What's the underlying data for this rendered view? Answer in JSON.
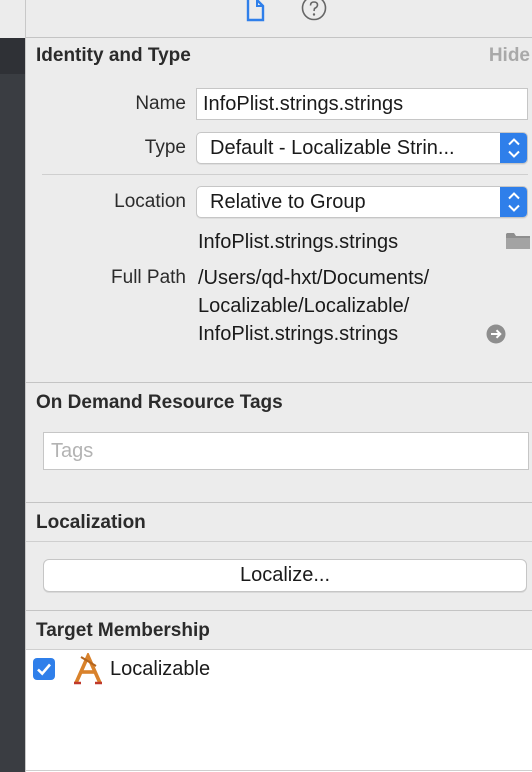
{
  "identity": {
    "title": "Identity and Type",
    "hide_label": "Hide",
    "name_label": "Name",
    "name_value": "InfoPlist.strings.strings",
    "type_label": "Type",
    "type_value": "Default - Localizable Strin...",
    "location_label": "Location",
    "location_value": "Relative to Group",
    "location_file": "InfoPlist.strings.strings",
    "full_path_label": "Full Path",
    "full_path_lines": [
      "/Users/qd-hxt/Documents/",
      "Localizable/Localizable/",
      "InfoPlist.strings.strings"
    ]
  },
  "on_demand": {
    "title": "On Demand Resource Tags",
    "tags_placeholder": "Tags"
  },
  "localization": {
    "title": "Localization",
    "localize_button": "Localize..."
  },
  "target_membership": {
    "title": "Target Membership",
    "targets": [
      {
        "label": "Localizable",
        "checked": true,
        "icon": "app-target-icon"
      }
    ]
  },
  "colors": {
    "accent": "#2f7fea",
    "panel_bg": "#ececec",
    "dark_sidebar": "#3a3d42"
  },
  "icons": {
    "file_inspector_tab": "file-icon",
    "help_tab": "help-icon",
    "reveal_folder": "folder-icon",
    "reveal_arrow": "arrow-right-circle-icon",
    "popup_stepper": "chevron-updown-icon"
  }
}
